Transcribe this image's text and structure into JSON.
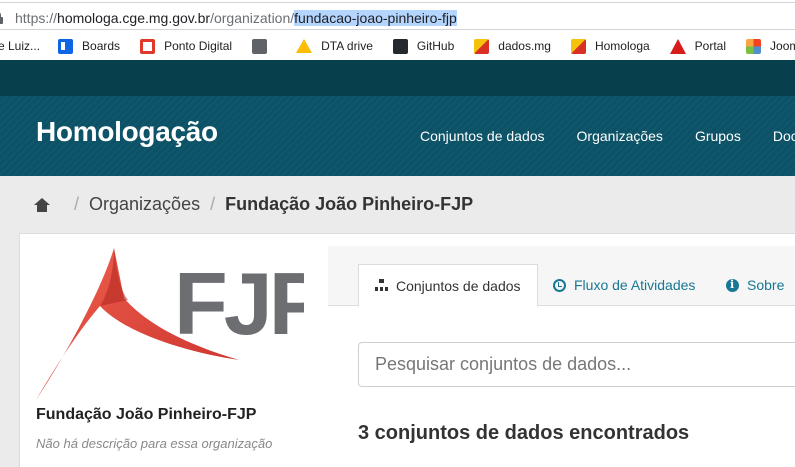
{
  "browser": {
    "url_prefix": "https://",
    "url_host": "homologa.cge.mg.gov.br",
    "url_path": "/organization/",
    "url_selected": "fundacao-joao-pinheiro-fjp"
  },
  "bookmarks": [
    {
      "label": "e Luiz...",
      "icon": "truncated-bookmark"
    },
    {
      "label": "Boards",
      "icon": "trello-icon"
    },
    {
      "label": "Ponto Digital",
      "icon": "g-logo-icon"
    },
    {
      "label": "",
      "icon": "globe-icon"
    },
    {
      "label": "DTA drive",
      "icon": "drive-icon"
    },
    {
      "label": "GitHub",
      "icon": "github-icon"
    },
    {
      "label": "dados.mg",
      "icon": "dados-icon"
    },
    {
      "label": "Homologa",
      "icon": "dados-icon"
    },
    {
      "label": "Portal",
      "icon": "portal-icon"
    },
    {
      "label": "Joomla PdT",
      "icon": "joomla-icon"
    }
  ],
  "header": {
    "site_title": "Homologação",
    "nav": [
      "Conjuntos de dados",
      "Organizações",
      "Grupos",
      "Doc"
    ]
  },
  "breadcrumb": {
    "items": [
      "Organizações",
      "Fundação João Pinheiro-FJP"
    ]
  },
  "sidebar": {
    "logo_text": "FJP",
    "org_name": "Fundação João Pinheiro-FJP",
    "org_description": "Não há descrição para essa organização"
  },
  "main": {
    "tabs": [
      {
        "label": "Conjuntos de dados",
        "icon": "sitemap-icon",
        "active": true
      },
      {
        "label": "Fluxo de Atividades",
        "icon": "clock-icon",
        "active": false
      },
      {
        "label": "Sobre",
        "icon": "info-icon",
        "active": false
      }
    ],
    "search_placeholder": "Pesquisar conjuntos de dados...",
    "results_text": "3 conjuntos de dados encontrados"
  },
  "colors": {
    "masthead": "#0b5266",
    "masthead_dark": "#073f4d",
    "link": "#187794",
    "logo_red": "#e8453c",
    "logo_gray": "#6d6e71"
  }
}
